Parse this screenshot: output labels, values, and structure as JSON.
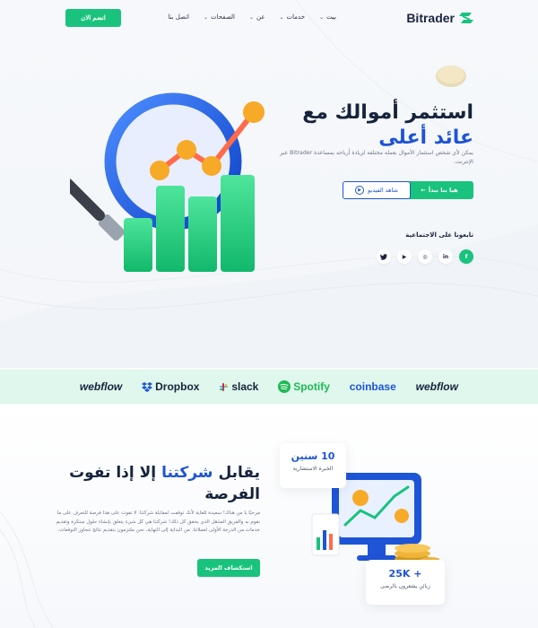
{
  "nav": {
    "brand": "Bitrader",
    "menu": [
      {
        "label": "بيت",
        "has_dropdown": true
      },
      {
        "label": "خدمات",
        "has_dropdown": true
      },
      {
        "label": "عن",
        "has_dropdown": true
      },
      {
        "label": "الصفحات",
        "has_dropdown": true
      },
      {
        "label": "اتصل بنا",
        "has_dropdown": false
      }
    ],
    "join_button": "انضم الان"
  },
  "hero": {
    "title_line1": "استثمر أموالك مع",
    "title_accent": "عائد أعلى",
    "description": "يمكن لأي شخص استثمار الأموال بعملة مختلفة لزيادة أرباحه بمساعدة Bitrader عبر الإنترنت.",
    "start_button": "هيا بنا نبدأ",
    "video_button": "شاهد الفيديو",
    "social_title": "تابعونا على الاجتماعية",
    "socials": [
      {
        "icon": "facebook-icon",
        "glyph": "f"
      },
      {
        "icon": "linkedin-icon",
        "glyph": "in"
      },
      {
        "icon": "instagram-icon",
        "glyph": "◎"
      },
      {
        "icon": "youtube-icon",
        "glyph": "▶"
      },
      {
        "icon": "twitter-icon",
        "glyph": "🐦"
      }
    ]
  },
  "brands": [
    "webflow",
    "Dropbox",
    "slack",
    "Spotify",
    "coinbase",
    "webflow"
  ],
  "about": {
    "title_part1": "يقابل",
    "title_accent": "شركتنا",
    "title_part2": "إلا إذا تفوت الفرصة",
    "description": "مرحبًا يا من هناك! سعيدة للغاية لأنك توقفت لمقابلة شركتنا. لا تفوت على هذا فرصة للتعرف على ما نقوم به والفريق المذهل الذي يحقق كل ذلك! شركتنا هي كل شيء يتعلق بإنشاء حلول مبتكرة وتقديم خدمات من الدرجة الأولى لعملائنا. من البداية إلى النهاية، نحن ملتزمون بتقديم نتائج تتجاوز التوقعات.",
    "button": "استكشاف المزيد",
    "experience_value": "10 سنين",
    "experience_label": "الخبرة الاستشارية",
    "clients_value": "25K +",
    "clients_label": "زبائن يشعرون بالرضى"
  },
  "colors": {
    "accent_green": "#19c37d",
    "accent_blue": "#1e54d6",
    "brands_band": "#dff7ec"
  }
}
